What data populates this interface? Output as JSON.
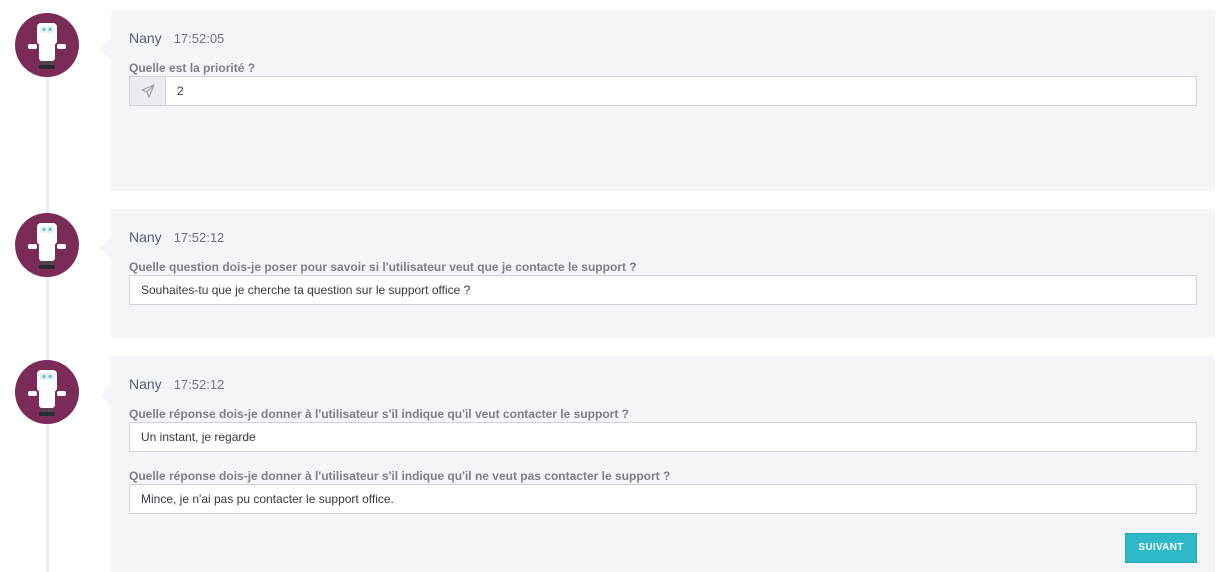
{
  "messages": [
    {
      "author": "Nany",
      "time": "17:52:05",
      "questions": [
        {
          "label": "Quelle est la priorité ?",
          "value": "2",
          "icon": "send-icon"
        }
      ]
    },
    {
      "author": "Nany",
      "time": "17:52:12",
      "questions": [
        {
          "label": "Quelle question dois-je poser pour savoir si l'utilisateur veut que je contacte le support ?",
          "value": "Souhaites-tu que je cherche ta question sur le support office ?"
        }
      ]
    },
    {
      "author": "Nany",
      "time": "17:52:12",
      "questions": [
        {
          "label": "Quelle réponse dois-je donner à l'utilisateur s'il indique qu'il veut contacter le support ?",
          "value": "Un instant, je regarde"
        },
        {
          "label": "Quelle réponse dois-je donner à l'utilisateur s'il indique qu'il ne veut pas contacter le support ?",
          "value": "Mince, je n'ai pas pu contacter le support office."
        }
      ],
      "next_button": "SUIVANT"
    }
  ],
  "colors": {
    "avatar_bg": "#7a2c56",
    "card_bg": "#f4f5f8",
    "accent": "#2fb9c8"
  },
  "avatar_icon": "robot-icon"
}
